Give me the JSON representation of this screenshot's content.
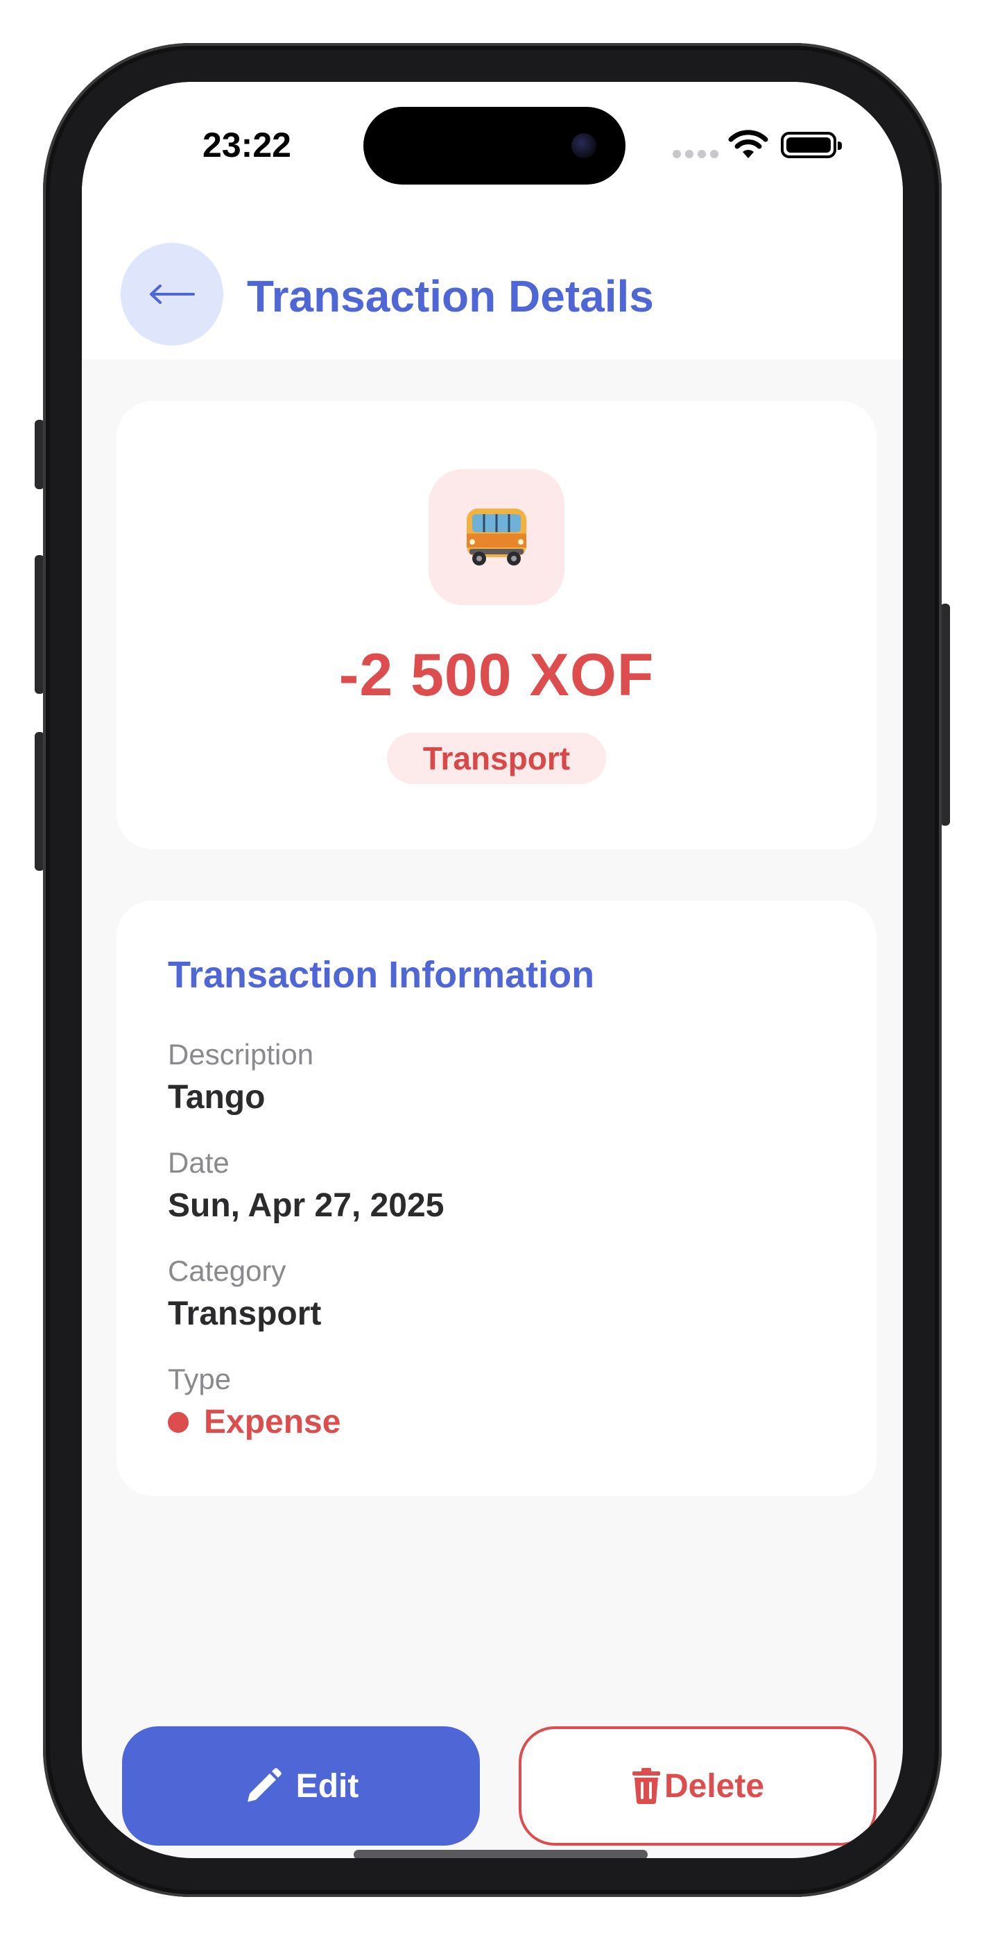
{
  "status_bar": {
    "time": "23:22"
  },
  "header": {
    "back_icon": "arrow-left-icon",
    "title": "Transaction Details"
  },
  "summary": {
    "category_icon": "bus-icon",
    "amount": "-2 500 XOF",
    "category_badge": "Transport"
  },
  "info": {
    "title": "Transaction Information",
    "fields": [
      {
        "label": "Description",
        "value": "Tango"
      },
      {
        "label": "Date",
        "value": "Sun, Apr 27, 2025"
      },
      {
        "label": "Category",
        "value": "Transport"
      },
      {
        "label": "Type",
        "value": "Expense"
      }
    ]
  },
  "actions": {
    "edit_label": "Edit",
    "edit_icon": "pencil-icon",
    "delete_label": "Delete",
    "delete_icon": "trash-icon"
  },
  "colors": {
    "accent": "#4f66d6",
    "expense": "#dd4d4d",
    "back_button_bg": "#dfe5fb",
    "badge_bg": "#fdeaea"
  }
}
